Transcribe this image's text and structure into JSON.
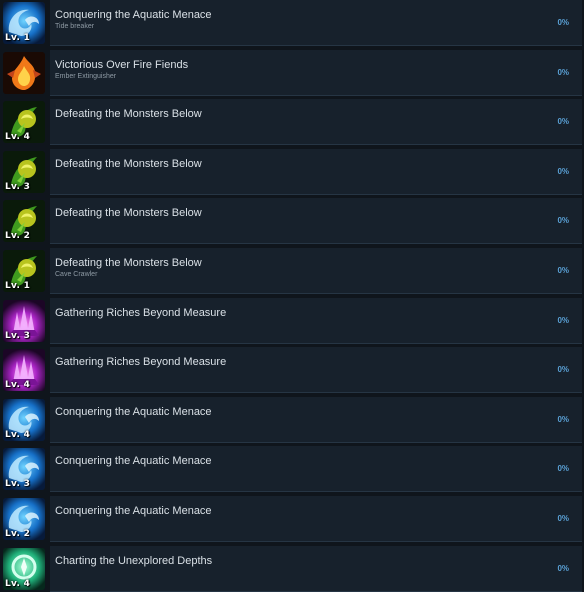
{
  "achievements": [
    {
      "title": "Conquering the Aquatic Menace",
      "subtitle": "Tide breaker",
      "level_badge": "Lv. 1",
      "percent": "0%",
      "icon": "wave-icon",
      "theme": "blue"
    },
    {
      "title": "Victorious Over Fire Fiends",
      "subtitle": "Ember Extinguisher",
      "level_badge": "",
      "percent": "0%",
      "icon": "flame-icon",
      "theme": "fire"
    },
    {
      "title": "Defeating the Monsters Below",
      "subtitle": "",
      "level_badge": "Lv. 4",
      "percent": "0%",
      "icon": "claw-icon",
      "theme": "green"
    },
    {
      "title": "Defeating the Monsters Below",
      "subtitle": "",
      "level_badge": "Lv. 3",
      "percent": "0%",
      "icon": "claw-icon",
      "theme": "green"
    },
    {
      "title": "Defeating the Monsters Below",
      "subtitle": "",
      "level_badge": "Lv. 2",
      "percent": "0%",
      "icon": "claw-icon",
      "theme": "green"
    },
    {
      "title": "Defeating the Monsters Below",
      "subtitle": "Cave Crawler",
      "level_badge": "Lv. 1",
      "percent": "0%",
      "icon": "claw-icon",
      "theme": "green"
    },
    {
      "title": "Gathering Riches Beyond Measure",
      "subtitle": "",
      "level_badge": "Lv. 3",
      "percent": "0%",
      "icon": "crystal-icon",
      "theme": "purple"
    },
    {
      "title": "Gathering Riches Beyond Measure",
      "subtitle": "",
      "level_badge": "Lv. 4",
      "percent": "0%",
      "icon": "crystal-icon",
      "theme": "purple"
    },
    {
      "title": "Conquering the Aquatic Menace",
      "subtitle": "",
      "level_badge": "Lv. 4",
      "percent": "0%",
      "icon": "wave-icon",
      "theme": "blue"
    },
    {
      "title": "Conquering the Aquatic Menace",
      "subtitle": "",
      "level_badge": "Lv. 3",
      "percent": "0%",
      "icon": "wave-icon",
      "theme": "blue"
    },
    {
      "title": "Conquering the Aquatic Menace",
      "subtitle": "",
      "level_badge": "Lv. 2",
      "percent": "0%",
      "icon": "wave-icon",
      "theme": "blue"
    },
    {
      "title": "Charting the Unexplored Depths",
      "subtitle": "",
      "level_badge": "Lv. 4",
      "percent": "0%",
      "icon": "compass-icon",
      "theme": "teal"
    }
  ],
  "colors": {
    "blue": "#1f8fe0",
    "fire": "#e8641a",
    "green": "#6cc229",
    "purple": "#c03ad8",
    "teal": "#34d29a",
    "percent": "#5aa1d6"
  }
}
